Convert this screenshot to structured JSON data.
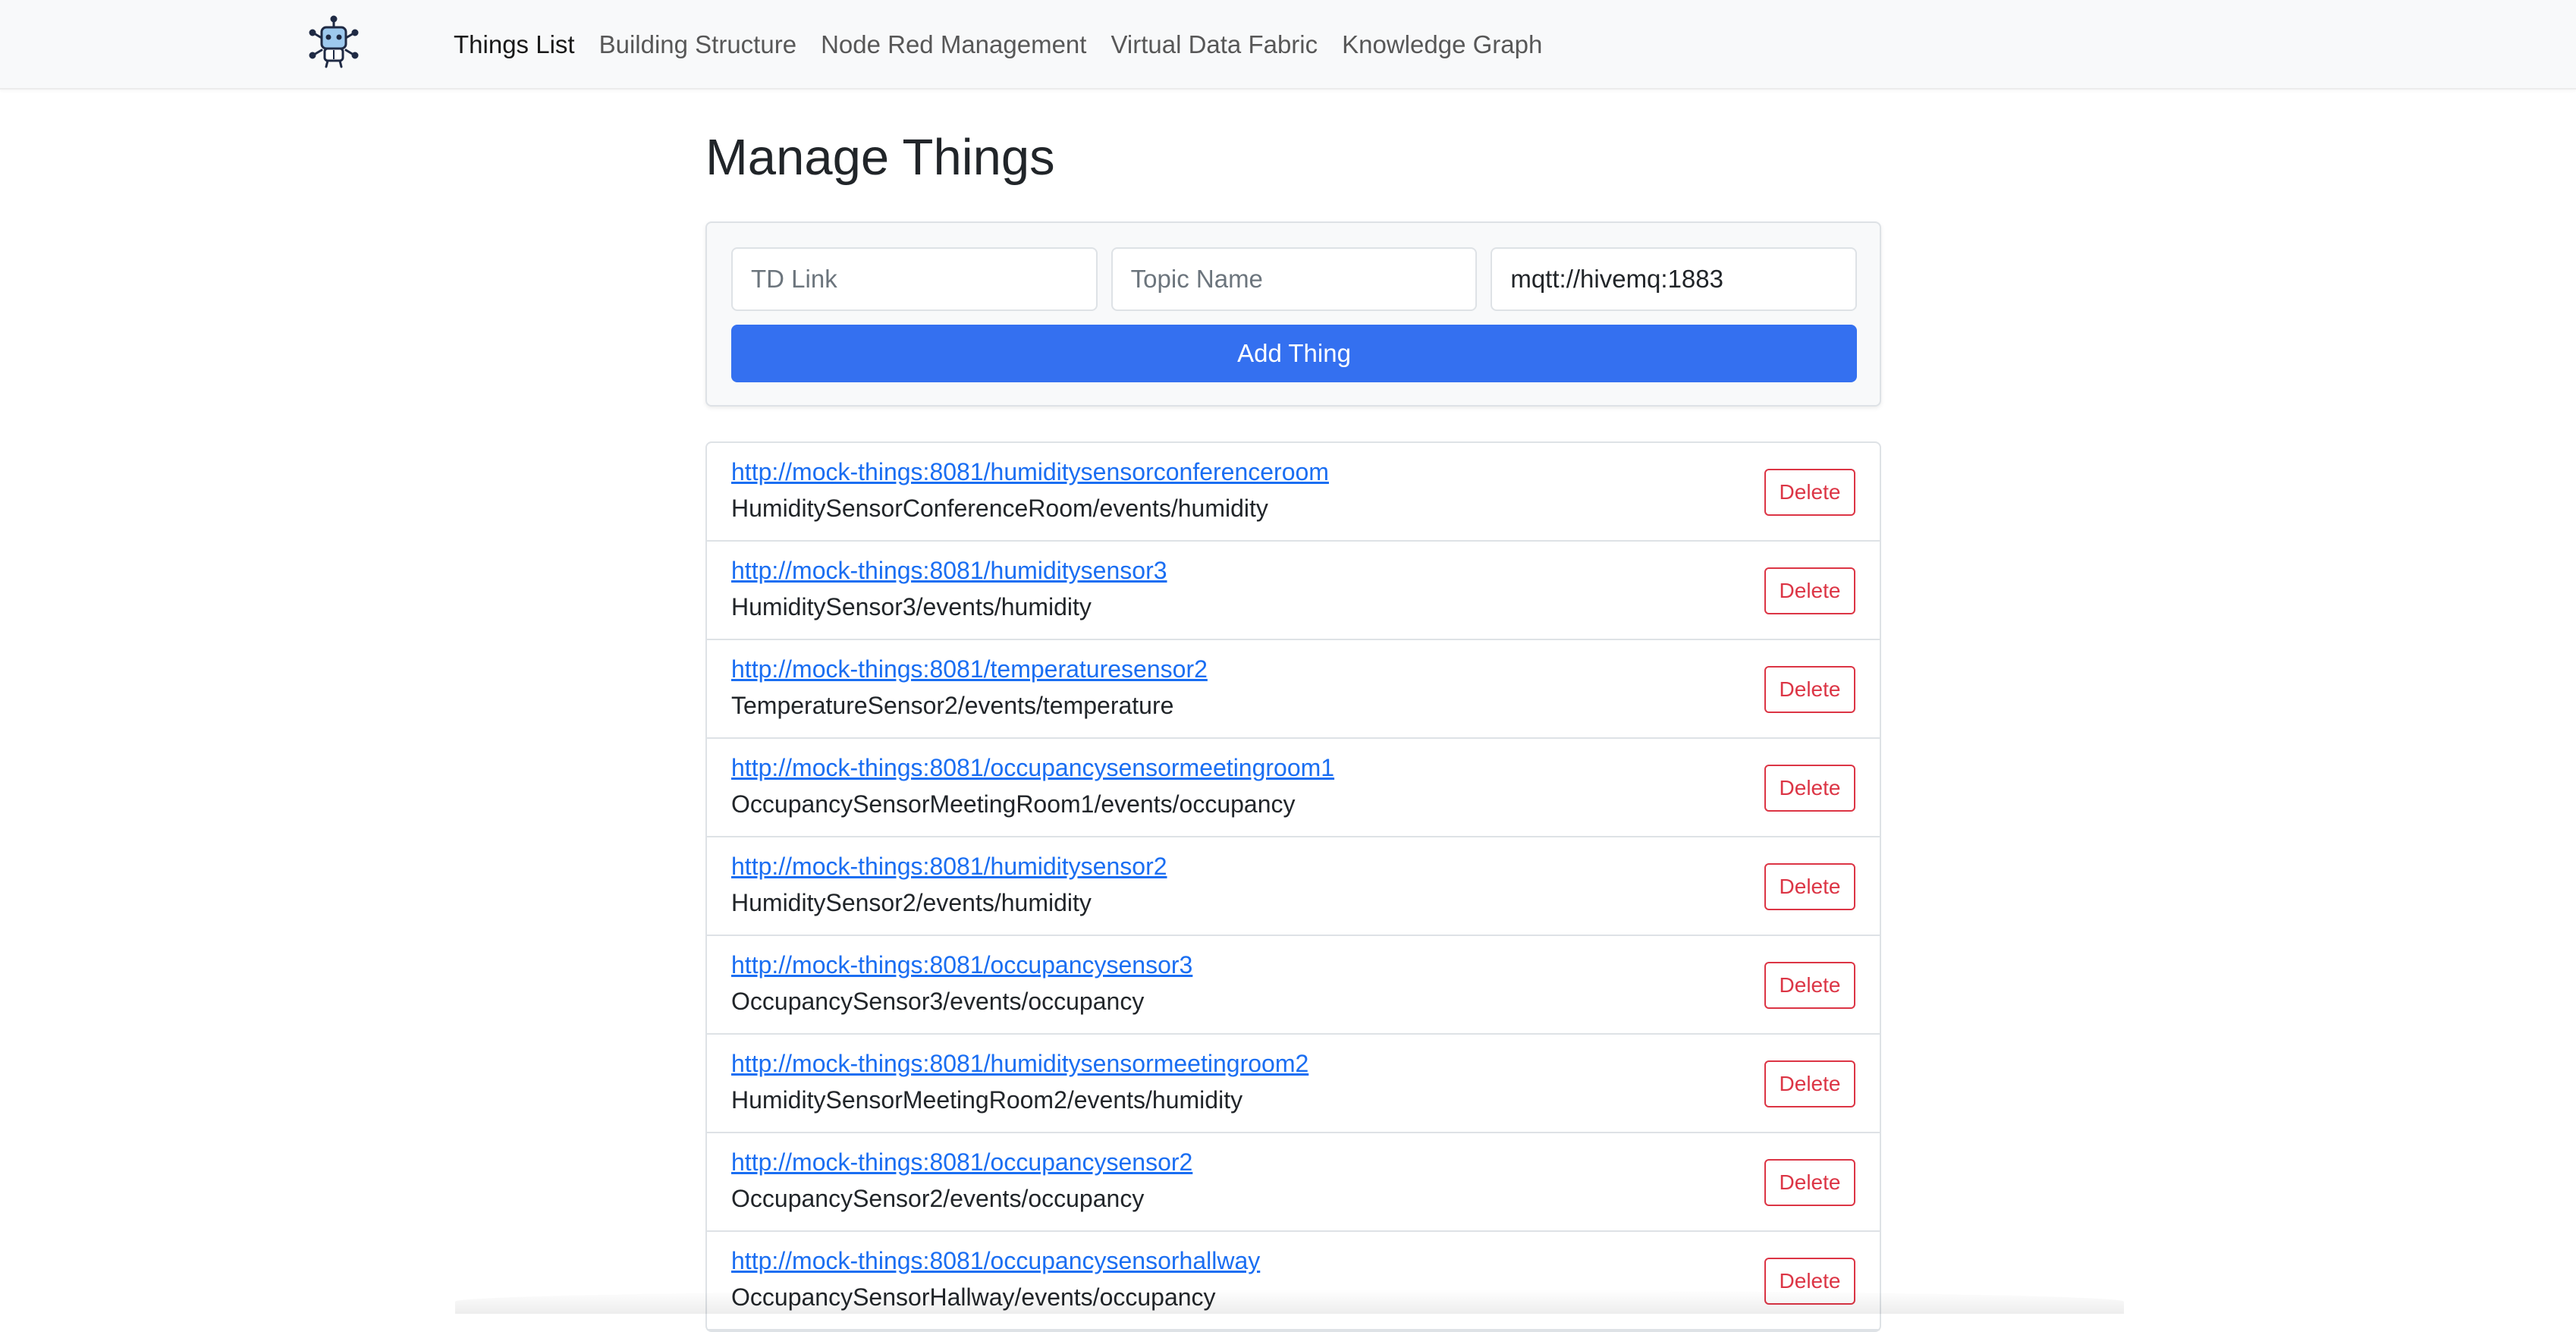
{
  "navbar": {
    "brand_icon": "robot-network-icon",
    "links": [
      {
        "label": "Things List",
        "active": true
      },
      {
        "label": "Building Structure",
        "active": false
      },
      {
        "label": "Node Red Management",
        "active": false
      },
      {
        "label": "Virtual Data Fabric",
        "active": false
      },
      {
        "label": "Knowledge Graph",
        "active": false
      }
    ]
  },
  "page": {
    "title": "Manage Things"
  },
  "form": {
    "td_link": {
      "placeholder": "TD Link",
      "value": ""
    },
    "topic_name": {
      "placeholder": "Topic Name",
      "value": ""
    },
    "broker": {
      "placeholder": "",
      "value": "mqtt://hivemq:1883"
    },
    "add_label": "Add Thing"
  },
  "things": [
    {
      "link": "http://mock-things:8081/humiditysensorconferenceroom",
      "topic": "HumiditySensorConferenceRoom/events/humidity",
      "delete_label": "Delete"
    },
    {
      "link": "http://mock-things:8081/humiditysensor3",
      "topic": "HumiditySensor3/events/humidity",
      "delete_label": "Delete"
    },
    {
      "link": "http://mock-things:8081/temperaturesensor2",
      "topic": "TemperatureSensor2/events/temperature",
      "delete_label": "Delete"
    },
    {
      "link": "http://mock-things:8081/occupancysensormeetingroom1",
      "topic": "OccupancySensorMeetingRoom1/events/occupancy",
      "delete_label": "Delete"
    },
    {
      "link": "http://mock-things:8081/humiditysensor2",
      "topic": "HumiditySensor2/events/humidity",
      "delete_label": "Delete"
    },
    {
      "link": "http://mock-things:8081/occupancysensor3",
      "topic": "OccupancySensor3/events/occupancy",
      "delete_label": "Delete"
    },
    {
      "link": "http://mock-things:8081/humiditysensormeetingroom2",
      "topic": "HumiditySensorMeetingRoom2/events/humidity",
      "delete_label": "Delete"
    },
    {
      "link": "http://mock-things:8081/occupancysensor2",
      "topic": "OccupancySensor2/events/occupancy",
      "delete_label": "Delete"
    },
    {
      "link": "http://mock-things:8081/occupancysensorhallway",
      "topic": "OccupancySensorHallway/events/occupancy",
      "delete_label": "Delete"
    }
  ],
  "colors": {
    "primary": "#3470f0",
    "link": "#1a6ef2",
    "danger": "#dc3545",
    "navbar_bg": "#f8f9fa"
  }
}
